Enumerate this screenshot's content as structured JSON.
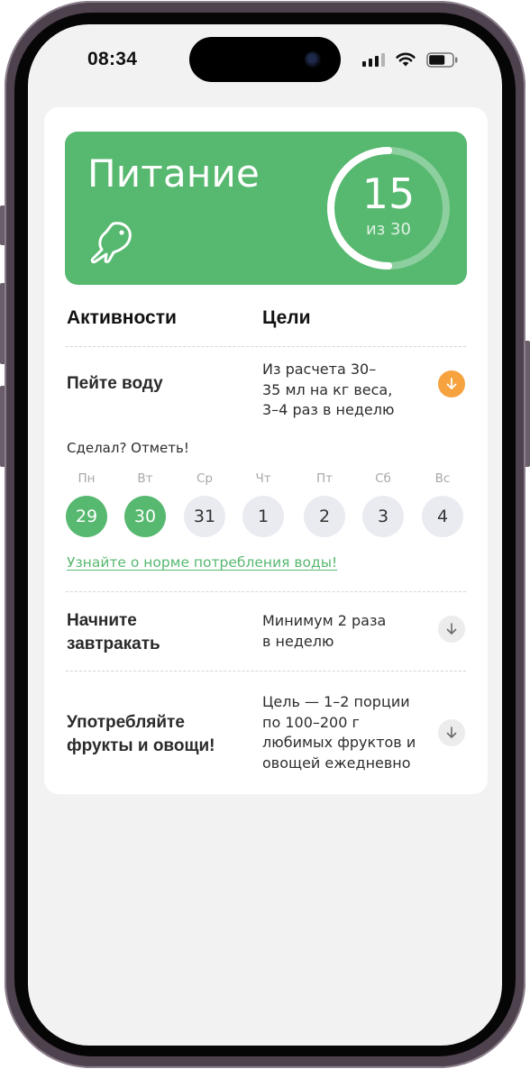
{
  "status_bar": {
    "time": "08:34",
    "icons": [
      "signal-icon",
      "wifi-icon",
      "battery-icon"
    ]
  },
  "banner": {
    "title": "Питание",
    "icon": "fish-icon",
    "progress_value": "15",
    "progress_total": "из 30",
    "progress_fraction": 0.5,
    "color": "#57b870"
  },
  "table_header": {
    "activities": "Активности",
    "goals": "Цели"
  },
  "activities": [
    {
      "title_lines": [
        "Пейте воду"
      ],
      "goal_lines": [
        "Из расчета 30–",
        "35 мл на кг веса,",
        "3–4 раз в неделю"
      ],
      "expanded": true,
      "arrow_color": "#f6a23e"
    },
    {
      "title_lines": [
        "Начните",
        "завтракать"
      ],
      "goal_lines": [
        "Минимум 2 раза",
        "в неделю"
      ],
      "expanded": false
    },
    {
      "title_lines": [
        "Употребляйте",
        "фрукты и овощи!"
      ],
      "goal_lines": [
        "Цель — 1–2 порции",
        "по 100–200 г",
        "любимых фруктов и",
        "овощей ежедневно"
      ],
      "expanded": false
    }
  ],
  "tracker": {
    "prompt": "Сделал? Отметь!",
    "days": [
      {
        "name": "Пн",
        "date": "29",
        "done": true
      },
      {
        "name": "Вт",
        "date": "30",
        "done": true
      },
      {
        "name": "Ср",
        "date": "31",
        "done": false
      },
      {
        "name": "Чт",
        "date": "1",
        "done": false
      },
      {
        "name": "Пт",
        "date": "2",
        "done": false
      },
      {
        "name": "Сб",
        "date": "3",
        "done": false
      },
      {
        "name": "Вс",
        "date": "4",
        "done": false
      }
    ],
    "link_text": "Узнайте о норме потребления воды!"
  },
  "colors": {
    "accent_green": "#57b870",
    "accent_orange": "#f6a23e",
    "day_inactive": "#e9ebf1"
  }
}
